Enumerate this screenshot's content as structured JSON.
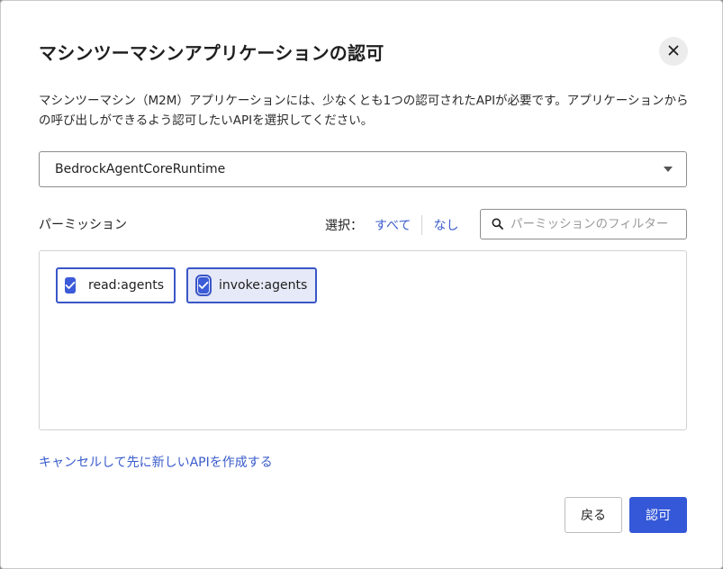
{
  "dialog": {
    "title": "マシンツーマシンアプリケーションの認可",
    "description": "マシンツーマシン（M2M）アプリケーションには、少なくとも1つの認可されたAPIが必要です。アプリケーションからの呼び出しができるよう認可したいAPIを選択してください。"
  },
  "api_select": {
    "selected_value": "BedrockAgentCoreRuntime"
  },
  "permissions": {
    "label": "パーミッション",
    "select_label": "選択：",
    "select_all": "すべて",
    "select_none": "なし",
    "filter_placeholder": "パーミッションのフィルター",
    "items": [
      {
        "label": "read:agents",
        "checked": true
      },
      {
        "label": "invoke:agents",
        "checked": true
      }
    ]
  },
  "footer": {
    "create_api_link": "キャンセルして先に新しいAPIを作成する",
    "back_label": "戻る",
    "authorize_label": "認可"
  },
  "colors": {
    "accent": "#3558d8",
    "link": "#3a5ccc",
    "checkbox": "#3b5bd9"
  },
  "icons": {
    "close": "close-icon",
    "dropdown": "chevron-down-icon",
    "search": "search-icon",
    "check": "checkmark-icon"
  }
}
